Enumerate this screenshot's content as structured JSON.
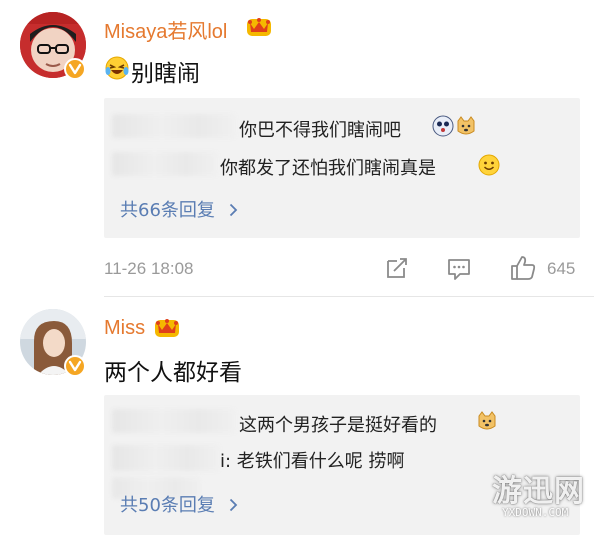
{
  "comments": [
    {
      "username": "Misaya若风lol",
      "text": "别瞎闹",
      "replies": [
        {
          "text": "你巴不得我们瞎闹吧"
        },
        {
          "text": "你都发了还怕我们瞎闹真是"
        }
      ],
      "more_replies": "共66条回复",
      "timestamp": "11-26 18:08",
      "like_count": "645"
    },
    {
      "username": "Miss",
      "text": "两个人都好看",
      "replies": [
        {
          "text": "这两个男孩子是挺好看的"
        },
        {
          "text": "i: 老铁们看什么呢  捞啊"
        }
      ],
      "more_replies": "共50条回复"
    }
  ],
  "watermark": {
    "main": "游迅网",
    "sub": "YXDOWN.COM"
  },
  "colors": {
    "username": "#e5792f",
    "link": "#5a7db3",
    "meta": "#9a9a9a",
    "reply_bg": "#f2f2f2",
    "verified_badge": "#f5a623"
  },
  "icons": {
    "verified": "v-badge-icon",
    "member": "crown-icon",
    "emoji_laugh": "laughing-tears-emoji",
    "emoji_dog": "doge-emoji",
    "emoji_smile": "smile-emoji",
    "repost": "repost-icon",
    "comment": "comment-icon",
    "like": "thumbs-up-icon",
    "chevron": "chevron-right-icon"
  }
}
